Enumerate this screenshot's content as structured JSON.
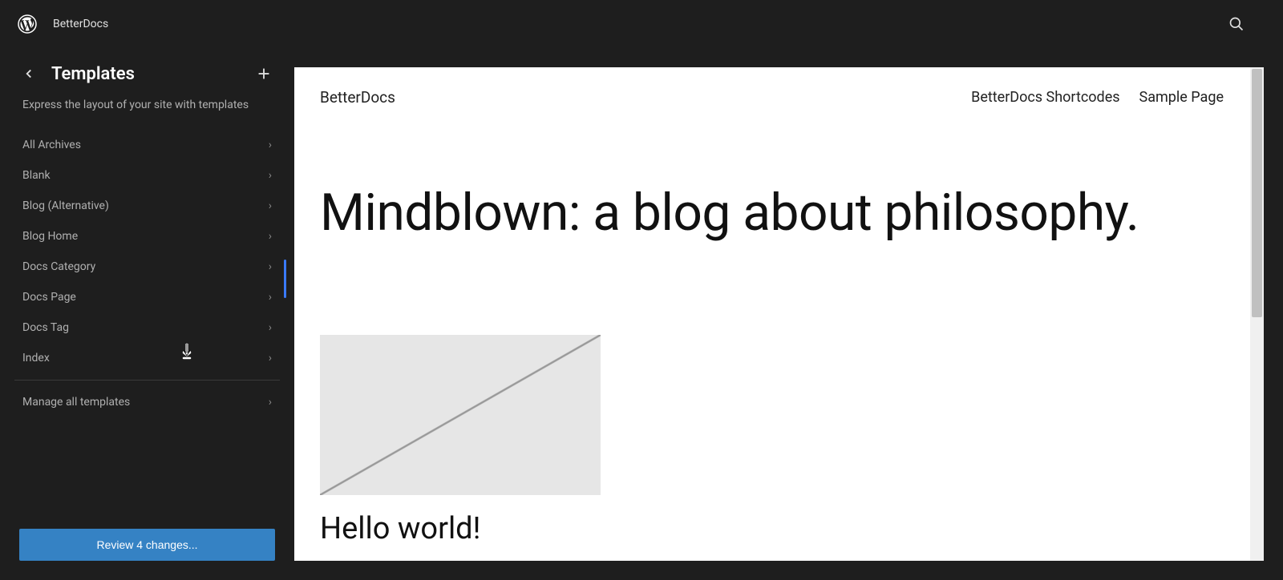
{
  "header": {
    "site_name": "BetterDocs"
  },
  "sidebar": {
    "title": "Templates",
    "description": "Express the layout of your site with templates",
    "templates": [
      {
        "label": "All Archives"
      },
      {
        "label": "Blank"
      },
      {
        "label": "Blog (Alternative)"
      },
      {
        "label": "Blog Home"
      },
      {
        "label": "Docs Category"
      },
      {
        "label": "Docs Page"
      },
      {
        "label": "Docs Tag"
      },
      {
        "label": "Index"
      }
    ],
    "manage_label": "Manage all templates",
    "review_button": "Review 4 changes..."
  },
  "preview": {
    "site_title": "BetterDocs",
    "nav_items": [
      {
        "label": "BetterDocs Shortcodes"
      },
      {
        "label": "Sample Page"
      }
    ],
    "heading": "Mindblown: a blog about philosophy.",
    "post_title": "Hello world!"
  }
}
